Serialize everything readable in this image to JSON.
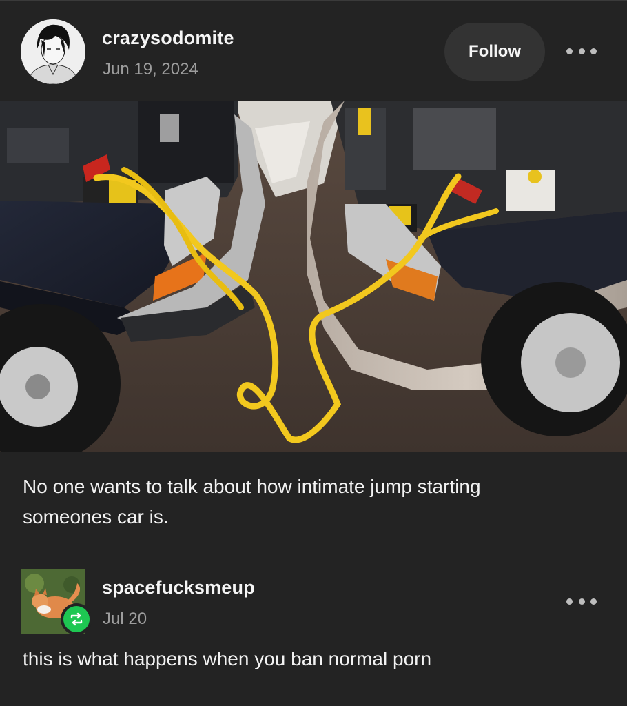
{
  "post": {
    "username": "crazysodomite",
    "date": "Jun 19, 2024",
    "follow_label": "Follow",
    "more_icon": "ellipsis-icon",
    "caption": "No one wants to talk about how intimate jump starting someones car is."
  },
  "reblog": {
    "username": "spacefucksmeup",
    "date": "Jul 20",
    "badge_icon": "reblog-icon",
    "badge_color": "#1ec752",
    "more_icon": "ellipsis-icon",
    "comment": "this is what happens when you ban normal porn"
  },
  "colors": {
    "background": "#232323",
    "cable": "#f2c81e"
  }
}
